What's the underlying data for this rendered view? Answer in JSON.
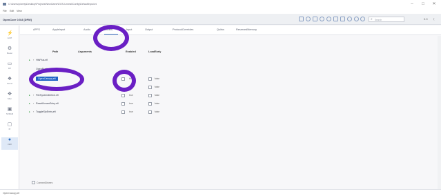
{
  "window": {
    "title": "C:\\Users\\p\\wmy\\Desktop\\Projects\\NewGame\\EOS-Unreal\\Config\\DefaultInput.ini",
    "min": "–",
    "max": "□",
    "close": "✕"
  },
  "menu": [
    "File",
    "Edit",
    "View"
  ],
  "toolbar": {
    "doc_title": "OpenCore 0.5.8 [DFM]",
    "search_placeholder": "Search",
    "right_a": "0.0",
    "right_b": "⟨"
  },
  "sidebar": [
    {
      "icon": "acpi-icon",
      "glyph": "⚡",
      "label": "ACPI"
    },
    {
      "icon": "booter-icon",
      "glyph": "⚙",
      "label": "Booter"
    },
    {
      "icon": "device-properties-icon",
      "glyph": "▭",
      "label": "DP"
    },
    {
      "icon": "kernel-icon",
      "glyph": "❖",
      "label": "Kernel"
    },
    {
      "icon": "misc-icon",
      "glyph": "✥",
      "label": "Misc"
    },
    {
      "icon": "nvram-icon",
      "glyph": "▣",
      "label": "NVRAM"
    },
    {
      "icon": "platform-info-icon",
      "glyph": "▢",
      "label": "PI"
    },
    {
      "icon": "uefi-icon",
      "glyph": "●",
      "label": "UEFI"
    }
  ],
  "tabs": [
    "APFS",
    "AppleInput",
    "Audio",
    "Drivers",
    "Input",
    "Output",
    "ProtocolOverrides",
    "Quirks",
    "ReservedMemory"
  ],
  "active_tab": "Drivers",
  "table": {
    "headers": [
      "Path",
      "Arguments",
      "Enabled",
      "LoadEarly"
    ],
    "rows": [
      {
        "path": "HfsPlus.efi",
        "enabled_text": "true",
        "load_early": "false"
      },
      {
        "path": "OpenRuntime.efi",
        "enabled_text": "true",
        "load_early": "false"
      },
      {
        "path": "OpenCanopy.efi",
        "enabled_text": "true",
        "load_early": "false",
        "highlighted": true
      },
      {
        "path": "",
        "enabled_text": "true",
        "load_early": "false"
      },
      {
        "path": "FileSystemDetect.efi",
        "enabled_text": "true",
        "load_early": "false"
      },
      {
        "path": "ResetNvramEntry.efi",
        "enabled_text": "true",
        "load_early": "false"
      },
      {
        "path": "ToggleSipEntry.efi",
        "enabled_text": "true",
        "load_early": "false"
      }
    ]
  },
  "footer": {
    "checkbox_label": "ConnectDrivers"
  },
  "status": {
    "text": "OpenCanopy.efi"
  },
  "accent": "#1f63c6",
  "annotation_color": "#6a1fc4"
}
